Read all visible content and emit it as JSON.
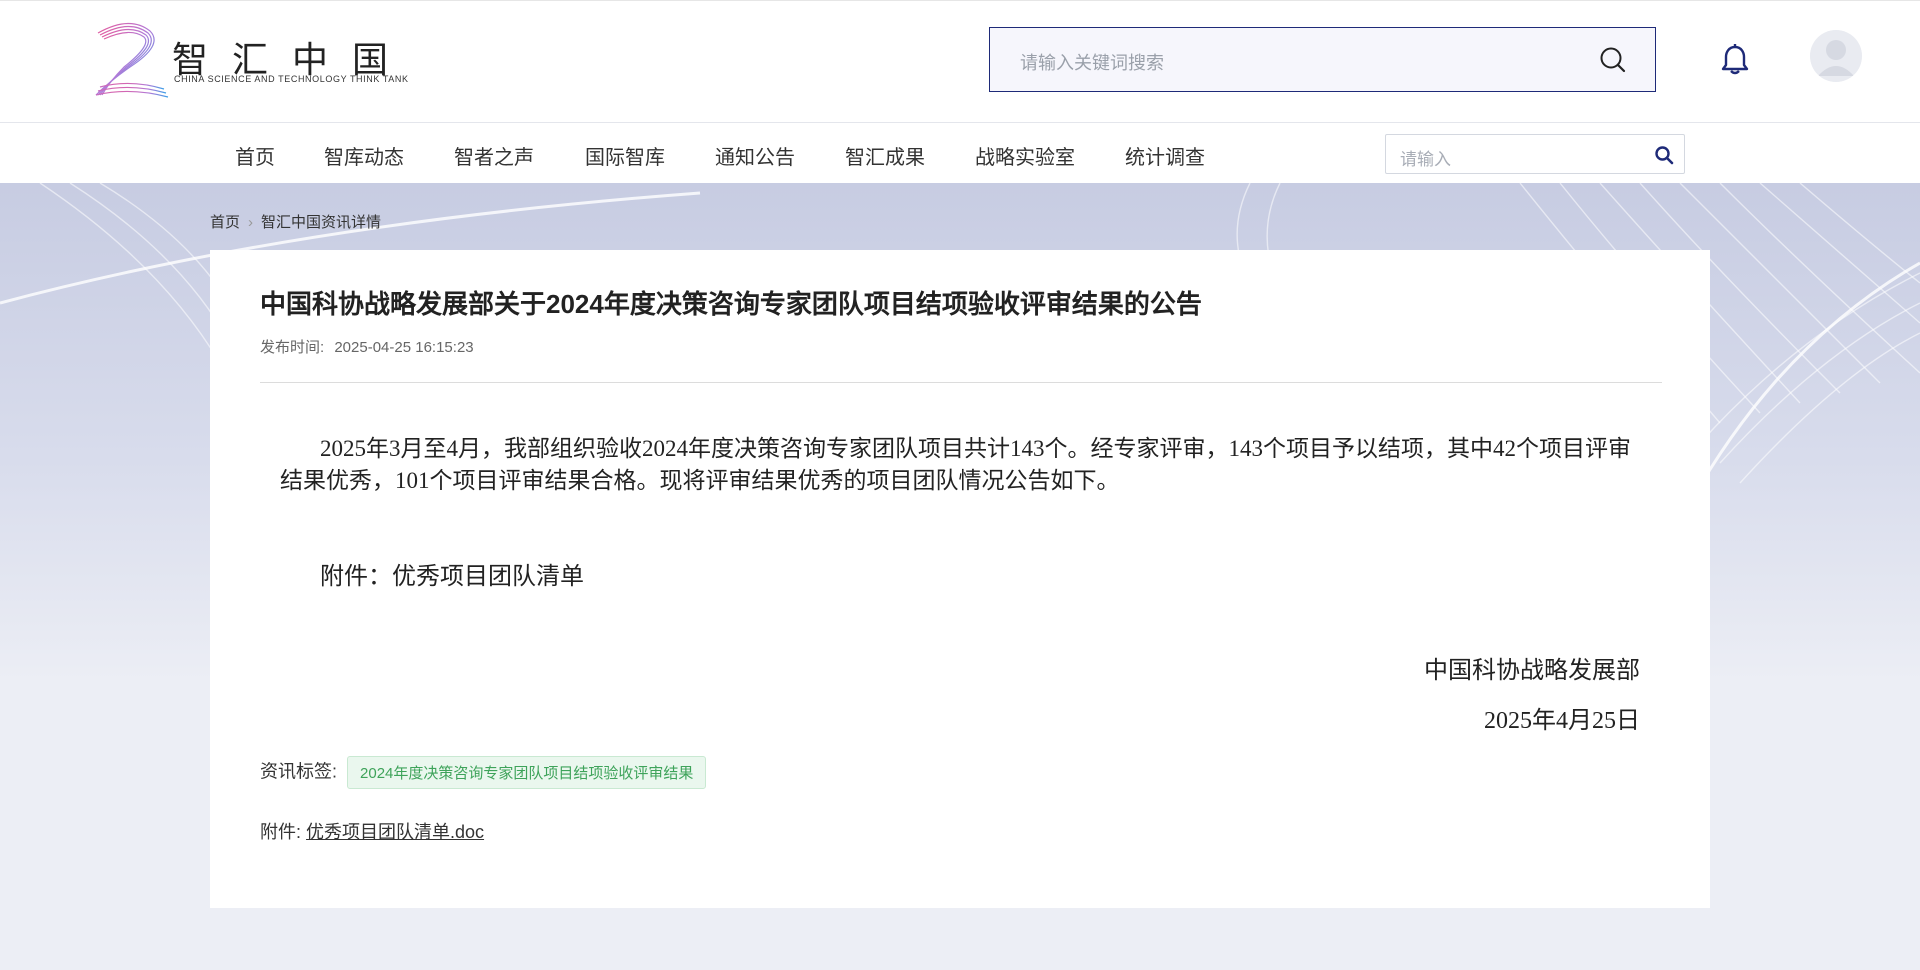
{
  "header": {
    "logo_cn": "智汇中国",
    "logo_en": "CHINA SCIENCE AND TECHNOLOGY THINK TANK",
    "search_placeholder": "请输入关键词搜索"
  },
  "nav": {
    "items": [
      "首页",
      "智库动态",
      "智者之声",
      "国际智库",
      "通知公告",
      "智汇成果",
      "战略实验室",
      "统计调查"
    ],
    "search_placeholder": "请输入"
  },
  "breadcrumb": {
    "home": "首页",
    "current": "智汇中国资讯详情"
  },
  "article": {
    "title": "中国科协战略发展部关于2024年度决策咨询专家团队项目结项验收评审结果的公告",
    "publish_label": "发布时间:",
    "publish_time": "2025-04-25 16:15:23",
    "paragraph": "2025年3月至4月，我部组织验收2024年度决策咨询专家团队项目共计143个。经专家评审，143个项目予以结项，其中42个项目评审结果优秀，101个项目评审结果合格。现将评审结果优秀的项目团队情况公告如下。",
    "attachment_line": "附件：优秀项目团队清单",
    "signature_org": "中国科协战略发展部",
    "signature_date": "2025年4月25日",
    "tags_label": "资讯标签:",
    "tag": "2024年度决策咨询专家团队项目结项验收评审结果",
    "file_label": "附件:",
    "file_name": "优秀项目团队清单.doc"
  },
  "colors": {
    "brand_navy": "#1e2a78",
    "tag_green": "#3ea35a",
    "tag_bg": "#eaf7ee",
    "page_bg": "#eceef5"
  }
}
